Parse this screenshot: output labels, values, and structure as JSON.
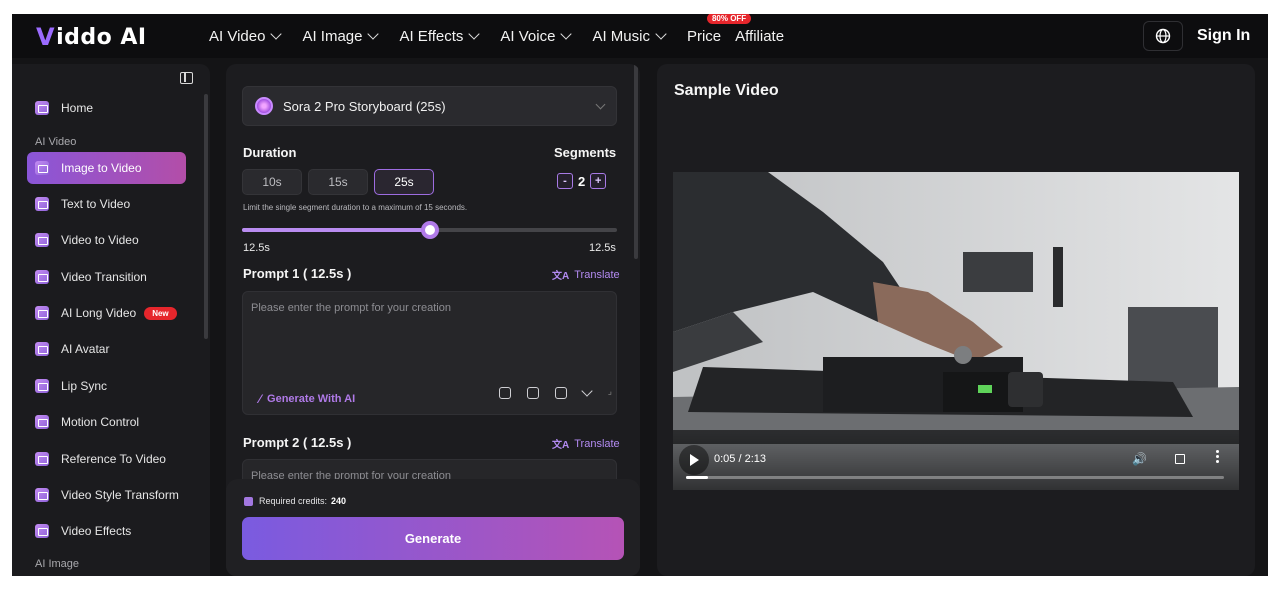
{
  "brand": {
    "name": "iddo AI",
    "mark": "V",
    "accent": "#9b6bff"
  },
  "nav": {
    "items": [
      {
        "label": "AI Video"
      },
      {
        "label": "AI Image"
      },
      {
        "label": "AI Effects"
      },
      {
        "label": "AI Voice"
      },
      {
        "label": "AI Music"
      }
    ],
    "price": "Price",
    "price_badge": "80% OFF",
    "affiliate": "Affiliate",
    "signin": "Sign In"
  },
  "sidebar": {
    "home": "Home",
    "section_video": "AI Video",
    "section_image": "AI Image",
    "items": [
      {
        "label": "Image to Video",
        "active": true
      },
      {
        "label": "Text to Video"
      },
      {
        "label": "Video to Video"
      },
      {
        "label": "Video Transition"
      },
      {
        "label": "AI Long Video",
        "badge": "New"
      },
      {
        "label": "AI Avatar"
      },
      {
        "label": "Lip Sync"
      },
      {
        "label": "Motion Control"
      },
      {
        "label": "Reference To Video"
      },
      {
        "label": "Video Style Transform"
      },
      {
        "label": "Video Effects"
      }
    ]
  },
  "form": {
    "model": "Sora 2 Pro Storyboard (25s)",
    "duration_label": "Duration",
    "segments_label": "Segments",
    "durations": [
      "10s",
      "15s",
      "25s"
    ],
    "selected_duration": "25s",
    "segments_value": "2",
    "minus": "-",
    "plus": "+",
    "hint": "Limit the single segment duration to a maximum of 15 seconds.",
    "slider_fraction": 0.5,
    "slider_left": "12.5s",
    "slider_right": "12.5s",
    "prompt1_label": "Prompt 1 ( 12.5s )",
    "prompt2_label": "Prompt 2 ( 12.5s )",
    "translate": "Translate",
    "placeholder": "Please enter the prompt for your creation",
    "generate_with_ai": "Generate With AI",
    "credits_label": "Required credits:",
    "credits_value": "240",
    "generate": "Generate"
  },
  "preview": {
    "title": "Sample Video",
    "time": "0:05 / 2:13",
    "progress_fraction": 0.04
  }
}
